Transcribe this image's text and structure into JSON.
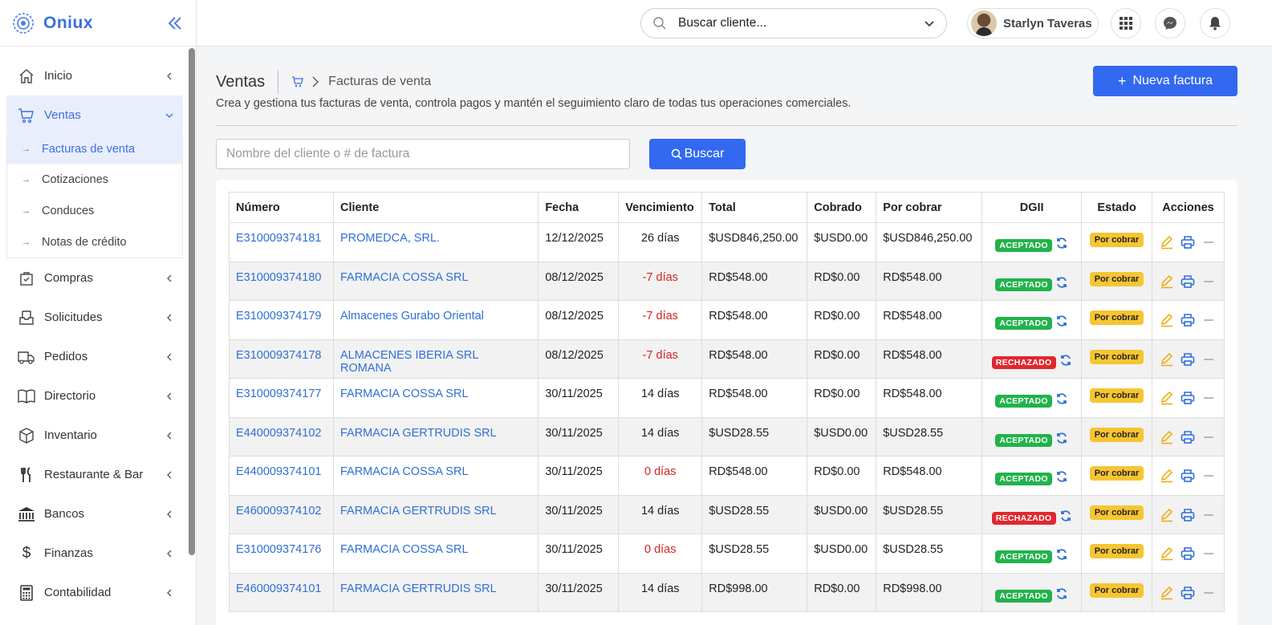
{
  "app": {
    "name": "Oniux"
  },
  "sidebar": {
    "items": [
      {
        "label": "Inicio",
        "icon": "home-icon"
      },
      {
        "label": "Ventas",
        "icon": "cart-icon",
        "active": true
      },
      {
        "label": "Compras",
        "icon": "bag-check-icon"
      },
      {
        "label": "Solicitudes",
        "icon": "inbox-icon"
      },
      {
        "label": "Pedidos",
        "icon": "truck-icon"
      },
      {
        "label": "Directorio",
        "icon": "book-icon"
      },
      {
        "label": "Inventario",
        "icon": "box-icon"
      },
      {
        "label": "Restaurante & Bar",
        "icon": "utensils-icon"
      },
      {
        "label": "Bancos",
        "icon": "bank-icon"
      },
      {
        "label": "Finanzas",
        "icon": "dollar-icon"
      },
      {
        "label": "Contabilidad",
        "icon": "calculator-icon"
      }
    ],
    "ventas_sub": [
      {
        "label": "Facturas de venta",
        "active": true
      },
      {
        "label": "Cotizaciones"
      },
      {
        "label": "Conduces"
      },
      {
        "label": "Notas de crédito"
      }
    ]
  },
  "header": {
    "client_search": "Buscar cliente...",
    "user_name": "Starlyn Taveras"
  },
  "page": {
    "title": "Ventas",
    "breadcrumb_current": "Facturas de venta",
    "subtitle": "Crea y gestiona tus facturas de venta, controla pagos y mantén el seguimiento claro de todas tus operaciones comerciales.",
    "new_button": "Nueva factura",
    "new_button_plus": "+",
    "filter_placeholder": "Nombre del cliente o # de factura",
    "search_button": "Buscar"
  },
  "table": {
    "headers": [
      "Número",
      "Cliente",
      "Fecha",
      "Vencimiento",
      "Total",
      "Cobrado",
      "Por cobrar",
      "DGII",
      "Estado",
      "Acciones"
    ],
    "rows": [
      {
        "numero": "E310009374181",
        "cliente": "PROMEDCA, SRL.",
        "fecha": "12/12/2025",
        "venc": "26 días",
        "venc_neg": false,
        "total": "$USD846,250.00",
        "cobrado": "$USD0.00",
        "por_cobrar": "$USD846,250.00",
        "dgii": "ACEPTADO",
        "dgii_ok": true,
        "estado": "Por cobrar"
      },
      {
        "numero": "E310009374180",
        "cliente": "FARMACIA COSSA SRL",
        "fecha": "08/12/2025",
        "venc": "-7 días",
        "venc_neg": true,
        "total": "RD$548.00",
        "cobrado": "RD$0.00",
        "por_cobrar": "RD$548.00",
        "dgii": "ACEPTADO",
        "dgii_ok": true,
        "estado": "Por cobrar"
      },
      {
        "numero": "E310009374179",
        "cliente": "Almacenes Gurabo Oriental",
        "fecha": "08/12/2025",
        "venc": "-7 días",
        "venc_neg": true,
        "total": "RD$548.00",
        "cobrado": "RD$0.00",
        "por_cobrar": "RD$548.00",
        "dgii": "ACEPTADO",
        "dgii_ok": true,
        "estado": "Por cobrar"
      },
      {
        "numero": "E310009374178",
        "cliente": "ALMACENES IBERIA SRL ROMANA",
        "fecha": "08/12/2025",
        "venc": "-7 días",
        "venc_neg": true,
        "total": "RD$548.00",
        "cobrado": "RD$0.00",
        "por_cobrar": "RD$548.00",
        "dgii": "RECHAZADO",
        "dgii_ok": false,
        "estado": "Por cobrar"
      },
      {
        "numero": "E310009374177",
        "cliente": "FARMACIA COSSA SRL",
        "fecha": "30/11/2025",
        "venc": "14 días",
        "venc_neg": false,
        "total": "RD$548.00",
        "cobrado": "RD$0.00",
        "por_cobrar": "RD$548.00",
        "dgii": "ACEPTADO",
        "dgii_ok": true,
        "estado": "Por cobrar"
      },
      {
        "numero": "E440009374102",
        "cliente": "FARMACIA GERTRUDIS SRL",
        "fecha": "30/11/2025",
        "venc": "14 días",
        "venc_neg": false,
        "total": "$USD28.55",
        "cobrado": "$USD0.00",
        "por_cobrar": "$USD28.55",
        "dgii": "ACEPTADO",
        "dgii_ok": true,
        "estado": "Por cobrar"
      },
      {
        "numero": "E440009374101",
        "cliente": "FARMACIA COSSA SRL",
        "fecha": "30/11/2025",
        "venc": "0 días",
        "venc_neg": true,
        "total": "RD$548.00",
        "cobrado": "RD$0.00",
        "por_cobrar": "RD$548.00",
        "dgii": "ACEPTADO",
        "dgii_ok": true,
        "estado": "Por cobrar"
      },
      {
        "numero": "E460009374102",
        "cliente": "FARMACIA GERTRUDIS SRL",
        "fecha": "30/11/2025",
        "venc": "14 días",
        "venc_neg": false,
        "total": "$USD28.55",
        "cobrado": "$USD0.00",
        "por_cobrar": "$USD28.55",
        "dgii": "RECHAZADO",
        "dgii_ok": false,
        "estado": "Por cobrar"
      },
      {
        "numero": "E310009374176",
        "cliente": "FARMACIA COSSA SRL",
        "fecha": "30/11/2025",
        "venc": "0 días",
        "venc_neg": true,
        "total": "$USD28.55",
        "cobrado": "$USD0.00",
        "por_cobrar": "$USD28.55",
        "dgii": "ACEPTADO",
        "dgii_ok": true,
        "estado": "Por cobrar"
      },
      {
        "numero": "E460009374101",
        "cliente": "FARMACIA GERTRUDIS SRL",
        "fecha": "30/11/2025",
        "venc": "14 días",
        "venc_neg": false,
        "total": "RD$998.00",
        "cobrado": "RD$0.00",
        "por_cobrar": "RD$998.00",
        "dgii": "ACEPTADO",
        "dgii_ok": true,
        "estado": "Por cobrar"
      }
    ]
  },
  "colors": {
    "primary": "#3369f0",
    "link": "#2f6fd6",
    "accepted": "#21b34a",
    "rejected": "#e0282f",
    "pending": "#f7c531",
    "negative": "#d32424"
  }
}
